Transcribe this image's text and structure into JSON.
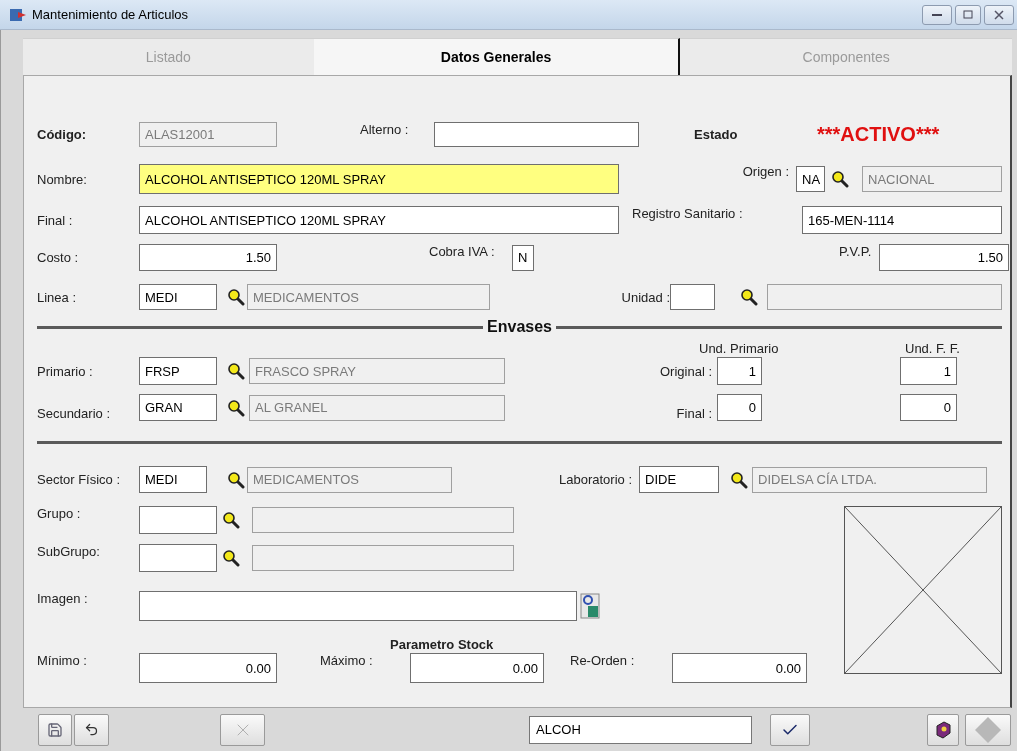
{
  "window": {
    "title": "Mantenimiento de Articulos"
  },
  "tabs": [
    {
      "label": "Listado",
      "selected": false
    },
    {
      "label": "Datos Generales",
      "selected": true
    },
    {
      "label": "Componentes",
      "selected": false
    }
  ],
  "general": {
    "codigo": {
      "label": "Código:",
      "value": "ALAS12001",
      "disabled": true
    },
    "alterno": {
      "label": "Alterno :",
      "disabled": false
    },
    "estado": {
      "label": "Estado",
      "value": "***ACTIVO***"
    },
    "nombre": {
      "label": "Nombre:",
      "value": "ALCOHOL ANTISEPTICO 120ML SPRAY",
      "disabled": false,
      "focused": true
    },
    "origen": {
      "label": "Origen :",
      "code": {
        "value": "NA",
        "disabled": false
      },
      "description": {
        "value": "NACIONAL",
        "disabled": true
      }
    },
    "final": {
      "label": "Final :",
      "value": "ALCOHOL ANTISEPTICO 120ML SPRAY",
      "disabled": false
    },
    "registro_sanitario": {
      "label": "Registro Sanitario :",
      "value": "165-MEN-1114",
      "disabled": false
    },
    "costo": {
      "label": "Costo :",
      "value": "1.50",
      "disabled": false
    },
    "cobra_iva": {
      "label": "Cobra IVA :",
      "value": "N",
      "disabled": false
    },
    "pvp": {
      "label": "P.V.P.",
      "value": "1.50",
      "disabled": false
    },
    "linea": {
      "label": "Linea :",
      "code": {
        "value": "MEDI",
        "disabled": false
      },
      "description": {
        "value": "MEDICAMENTOS",
        "disabled": true
      }
    },
    "unidad": {
      "label": "Unidad :",
      "code": {
        "disabled": false
      },
      "description": {
        "disabled": true
      }
    }
  },
  "envases": {
    "title": "Envases",
    "column_1": "Und. Primario",
    "column_2": "Und. F. F.",
    "primario": {
      "label": "Primario :",
      "code": {
        "value": "FRSP",
        "disabled": false
      },
      "description": {
        "value": "FRASCO SPRAY",
        "disabled": true
      }
    },
    "secundario": {
      "label": "Secundario :",
      "code": {
        "value": "GRAN",
        "disabled": false
      },
      "description": {
        "value": "AL GRANEL",
        "disabled": true
      }
    },
    "original": {
      "label": "Original :",
      "primario": {
        "value": "1",
        "disabled": false
      },
      "ff": {
        "value": "1",
        "disabled": false
      }
    },
    "final": {
      "label": "Final :",
      "primario": {
        "value": "0",
        "disabled": false
      },
      "ff": {
        "value": "0",
        "disabled": false
      }
    }
  },
  "clasificacion": {
    "sector_fisico": {
      "label": "Sector Físico :",
      "code": {
        "value": "MEDI",
        "disabled": false
      },
      "description": {
        "value": "MEDICAMENTOS",
        "disabled": true
      }
    },
    "laboratorio": {
      "label": "Laboratorio :",
      "code": {
        "value": "DIDE",
        "disabled": false
      },
      "description": {
        "value": "DIDELSA CÍA LTDA.",
        "disabled": true
      }
    },
    "grupo": {
      "label": "Grupo :",
      "code": {
        "disabled": false
      },
      "description": {
        "disabled": true
      }
    },
    "subgrupo": {
      "label": "SubGrupo:",
      "code": {
        "disabled": false
      },
      "description": {
        "disabled": true
      }
    },
    "imagen": {
      "label": "Imagen :",
      "disabled": false
    }
  },
  "parametro_stock": {
    "title": "Parametro Stock",
    "minimo": {
      "label": "Mínimo :",
      "value": "0.00",
      "disabled": false
    },
    "maximo": {
      "label": "Máximo :",
      "value": "0.00",
      "disabled": false
    },
    "reorden": {
      "label": "Re-Orden :",
      "value": "0.00",
      "disabled": false
    }
  },
  "toolbar": [
    {
      "kind": "save",
      "disabled": false
    },
    {
      "kind": "undo",
      "disabled": false
    },
    {
      "kind": "cancel",
      "disabled": true
    },
    {
      "kind": "search",
      "value": "ALCOH"
    },
    {
      "kind": "accept",
      "disabled": false
    },
    {
      "kind": "help",
      "disabled": false
    },
    {
      "kind": "diamond",
      "disabled": true
    }
  ]
}
